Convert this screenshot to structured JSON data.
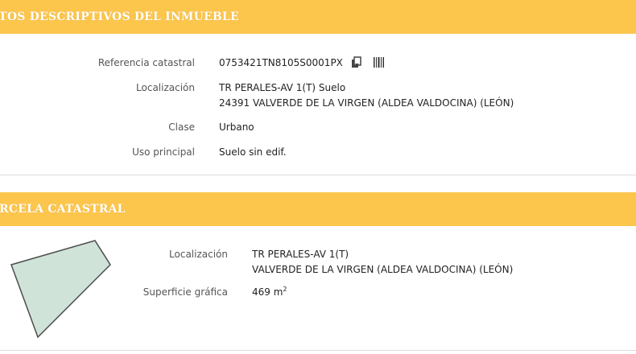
{
  "inmueble": {
    "title": "ATOS DESCRIPTIVOS DEL INMUEBLE",
    "fields": {
      "ref_label": "Referencia catastral",
      "ref_value": "0753421TN8105S0001PX",
      "loc_label": "Localización",
      "loc_line1": "TR PERALES-AV 1(T) Suelo",
      "loc_line2": "24391 VALVERDE DE LA VIRGEN (ALDEA VALDOCINA) (LEÓN)",
      "clase_label": "Clase",
      "clase_value": "Urbano",
      "uso_label": "Uso principal",
      "uso_value": "Suelo sin edif."
    },
    "icons": [
      "copy-icon",
      "barcode-icon"
    ]
  },
  "parcela": {
    "title": "ARCELA CATASTRAL",
    "fields": {
      "loc_label": "Localización",
      "loc_line1": "TR PERALES-AV 1(T)",
      "loc_line2": "VALVERDE DE LA VIRGEN (ALDEA VALDOCINA) (LEÓN)",
      "sup_label": "Superficie gráfica",
      "sup_value": "469 m",
      "sup_unit_exp": "2"
    }
  },
  "colors": {
    "header": "#fcc64d",
    "parcel_fill": "#cfe3d9",
    "parcel_stroke": "#4d4d4d"
  }
}
